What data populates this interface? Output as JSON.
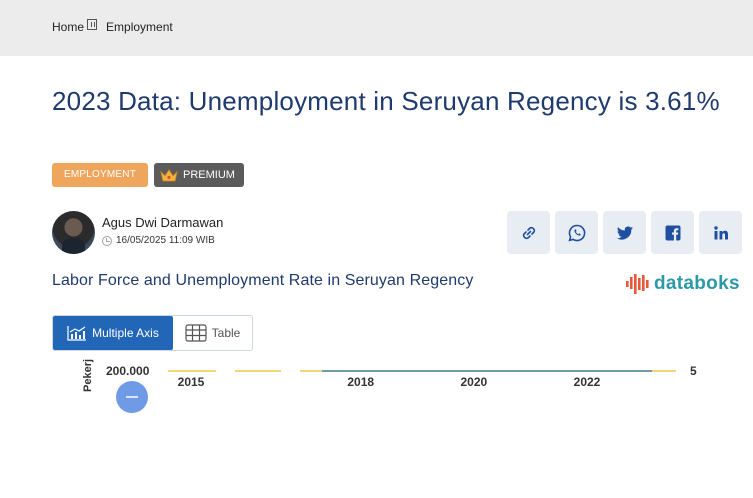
{
  "breadcrumb": {
    "home": "Home",
    "current": "Employment"
  },
  "article": {
    "title": "2023 Data: Unemployment in Seruyan Regency is 3.61%",
    "tags": {
      "category": "EMPLOYMENT",
      "premium": "PREMIUM"
    },
    "author": {
      "name": "Agus Dwi Darmawan",
      "date": "16/05/2025 11:09 WIB"
    }
  },
  "share_icons": [
    "link-icon",
    "whatsapp-icon",
    "twitter-icon",
    "facebook-icon",
    "linkedin-icon"
  ],
  "chart_section": {
    "title": "Labor Force and Unemployment Rate in Seruyan Regency",
    "brand": "databoks",
    "view_toggle": {
      "multi": "Multiple Axis",
      "table": "Table"
    }
  },
  "colors": {
    "accent_blue": "#2266b8",
    "tag_orange": "#f0a55d",
    "title_navy": "#1f3a6d",
    "brand_teal": "#2b9aa6",
    "series_yellow": "#f3c64a",
    "series_teal": "#3f7f8f"
  },
  "chart_data": {
    "type": "line",
    "x": [
      "2015",
      "2018",
      "2020",
      "2022"
    ],
    "ylabel_left": "Pekerj",
    "left_tick": "200.000",
    "right_tick": "5",
    "series": []
  }
}
